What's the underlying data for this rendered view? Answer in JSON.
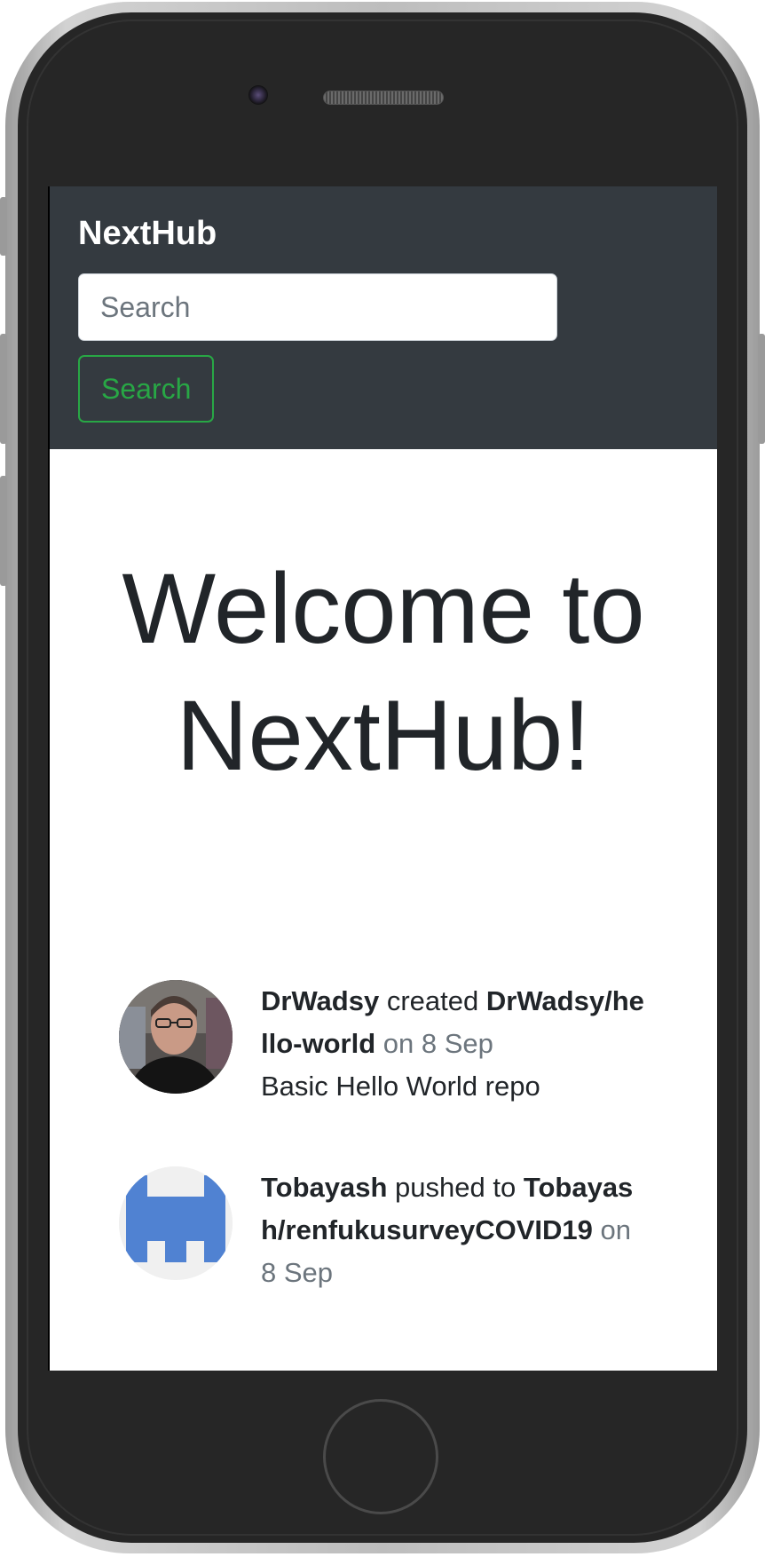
{
  "navbar": {
    "brand": "NextHub",
    "search_placeholder": "Search",
    "search_button": "Search"
  },
  "hero": {
    "title": "Welcome to NextHub!"
  },
  "feed": [
    {
      "user": "DrWadsy",
      "action": "created",
      "repo": "DrWadsy/hello-world",
      "date": "on 8 Sep",
      "description": "Basic Hello World repo"
    },
    {
      "user": "Tobayash",
      "action": "pushed to",
      "repo": "Tobayash/renfukusurveyCOVID19",
      "date": "on 8 Sep",
      "description": ""
    }
  ],
  "colors": {
    "navbar_bg": "#343a40",
    "success": "#28a745",
    "muted": "#6c757d",
    "text": "#212529",
    "identicon": "#5082d2"
  }
}
